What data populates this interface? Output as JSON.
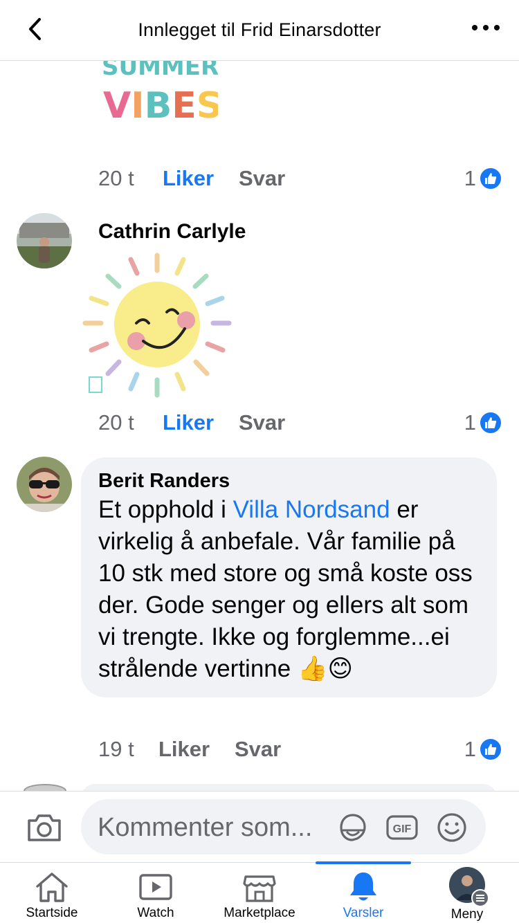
{
  "header": {
    "title": "Innlegget til Frid Einarsdotter"
  },
  "sticker_top": {
    "line1": "SUMMER",
    "line2": "VIBES"
  },
  "comments": [
    {
      "time": "20 t",
      "like_label": "Liker",
      "reply_label": "Svar",
      "reaction_count": "1"
    },
    {
      "name": "Cathrin Carlyle",
      "time": "20 t",
      "like_label": "Liker",
      "reply_label": "Svar",
      "reaction_count": "1"
    },
    {
      "name": "Berit Randers",
      "text_before": "Et opphold i ",
      "link_text": "Villa Nordsand",
      "text_after": "  er virkelig å anbefale. Vår familie på 10 stk med store og små koste oss der. Gode senger og ellers alt som vi trengte. Ikke og forglemme...ei strålende vertinne ",
      "emoji": "👍😊",
      "time": "19 t",
      "like_label": "Liker",
      "reply_label": "Svar",
      "reaction_count": "1"
    }
  ],
  "compose": {
    "placeholder": "Kommenter som...",
    "gif_label": "GIF"
  },
  "tabbar": {
    "items": [
      {
        "label": "Startside",
        "icon": "home-icon"
      },
      {
        "label": "Watch",
        "icon": "watch-icon"
      },
      {
        "label": "Marketplace",
        "icon": "marketplace-icon"
      },
      {
        "label": "Varsler",
        "icon": "bell-icon"
      },
      {
        "label": "Meny",
        "icon": "menu-avatar"
      }
    ],
    "active": "Varsler"
  },
  "colors": {
    "accent": "#1877f2",
    "secondary_text": "#65676b",
    "bubble_bg": "#f0f2f5"
  }
}
